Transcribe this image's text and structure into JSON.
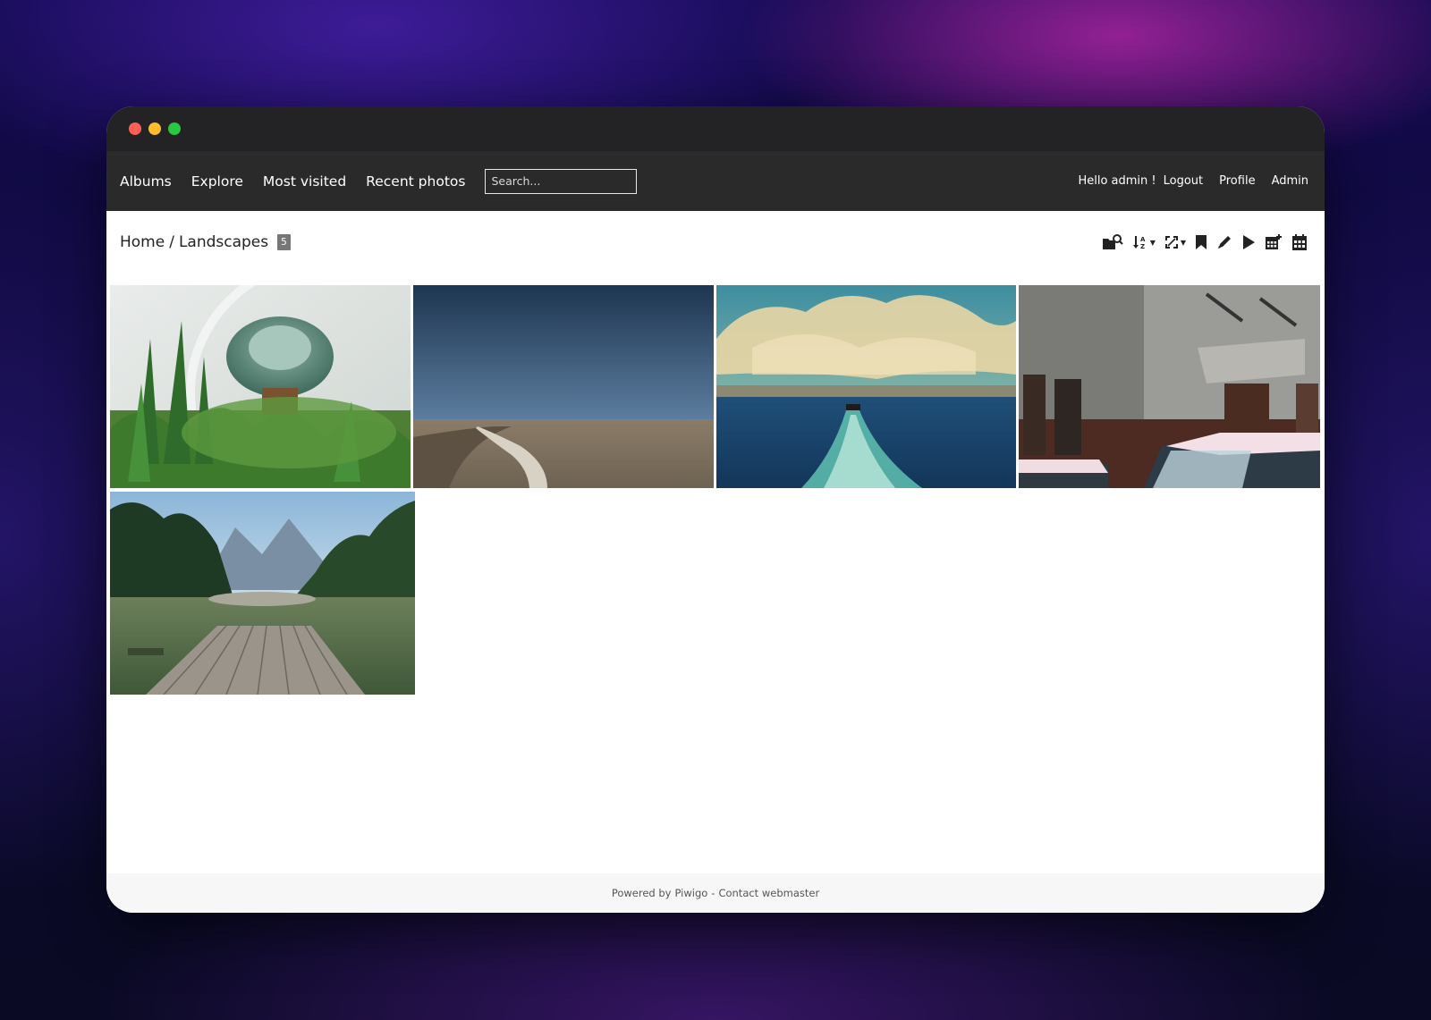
{
  "window_controls": [
    "close",
    "minimize",
    "maximize"
  ],
  "nav": {
    "links": [
      "Albums",
      "Explore",
      "Most visited",
      "Recent photos"
    ],
    "search_placeholder": "Search...",
    "greeting": "Hello admin !",
    "logout": "Logout",
    "profile": "Profile",
    "admin": "Admin"
  },
  "breadcrumb": {
    "home": "Home",
    "separator": "/",
    "current": "Landscapes",
    "count": "5"
  },
  "toolbar": {
    "icons": [
      "search-album-icon",
      "sort-order-icon",
      "photo-size-icon",
      "bookmark-icon",
      "edit-icon",
      "slideshow-icon",
      "calendar-posted-icon",
      "calendar-icon"
    ]
  },
  "gallery": {
    "photos": [
      {
        "subject": "succulent terrarium"
      },
      {
        "subject": "dirt road through field"
      },
      {
        "subject": "boat wake on sea"
      },
      {
        "subject": "old building with snowy cars"
      },
      {
        "subject": "wooden dock on mountain lake"
      }
    ]
  },
  "footer": {
    "powered": "Powered by",
    "piwigo": "Piwigo",
    "dash": "-",
    "contact": "Contact webmaster"
  },
  "colors": {
    "navbar": "#2a2a2a",
    "titlebar": "#232325",
    "badge": "#777777",
    "footer_bg": "#f7f7f7"
  }
}
